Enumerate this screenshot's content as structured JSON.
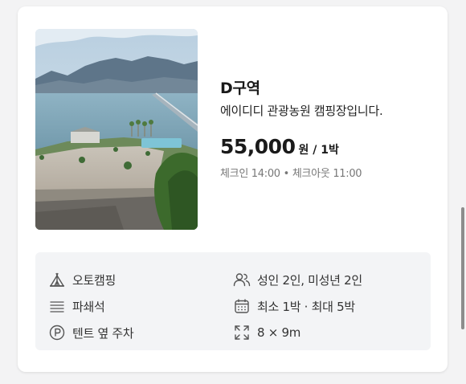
{
  "zone": {
    "name": "D구역",
    "description": "에이디디 관광농원 캠핑장입니다."
  },
  "pricing": {
    "price": "55,000",
    "unit": "원 / 1박"
  },
  "schedule": {
    "checkin": "체크인 14:00",
    "separator": "•",
    "checkout": "체크아웃 11:00"
  },
  "features": {
    "camping_type": "오토캠핑",
    "floor_type": "파쇄석",
    "parking": "텐트 옆 주차",
    "occupancy": "성인 2인, 미성년 2인",
    "stay": "최소 1박 · 최대 5박",
    "size": "8 × 9m"
  },
  "icons": {
    "camping_type": "tent-icon",
    "floor_type": "gravel-icon",
    "parking": "parking-icon",
    "occupancy": "people-icon",
    "stay": "calendar-icon",
    "size": "expand-icon"
  },
  "colors": {
    "text": "#1a1a1a",
    "muted": "#777777",
    "panel": "#f3f4f6",
    "icon": "#555555"
  }
}
